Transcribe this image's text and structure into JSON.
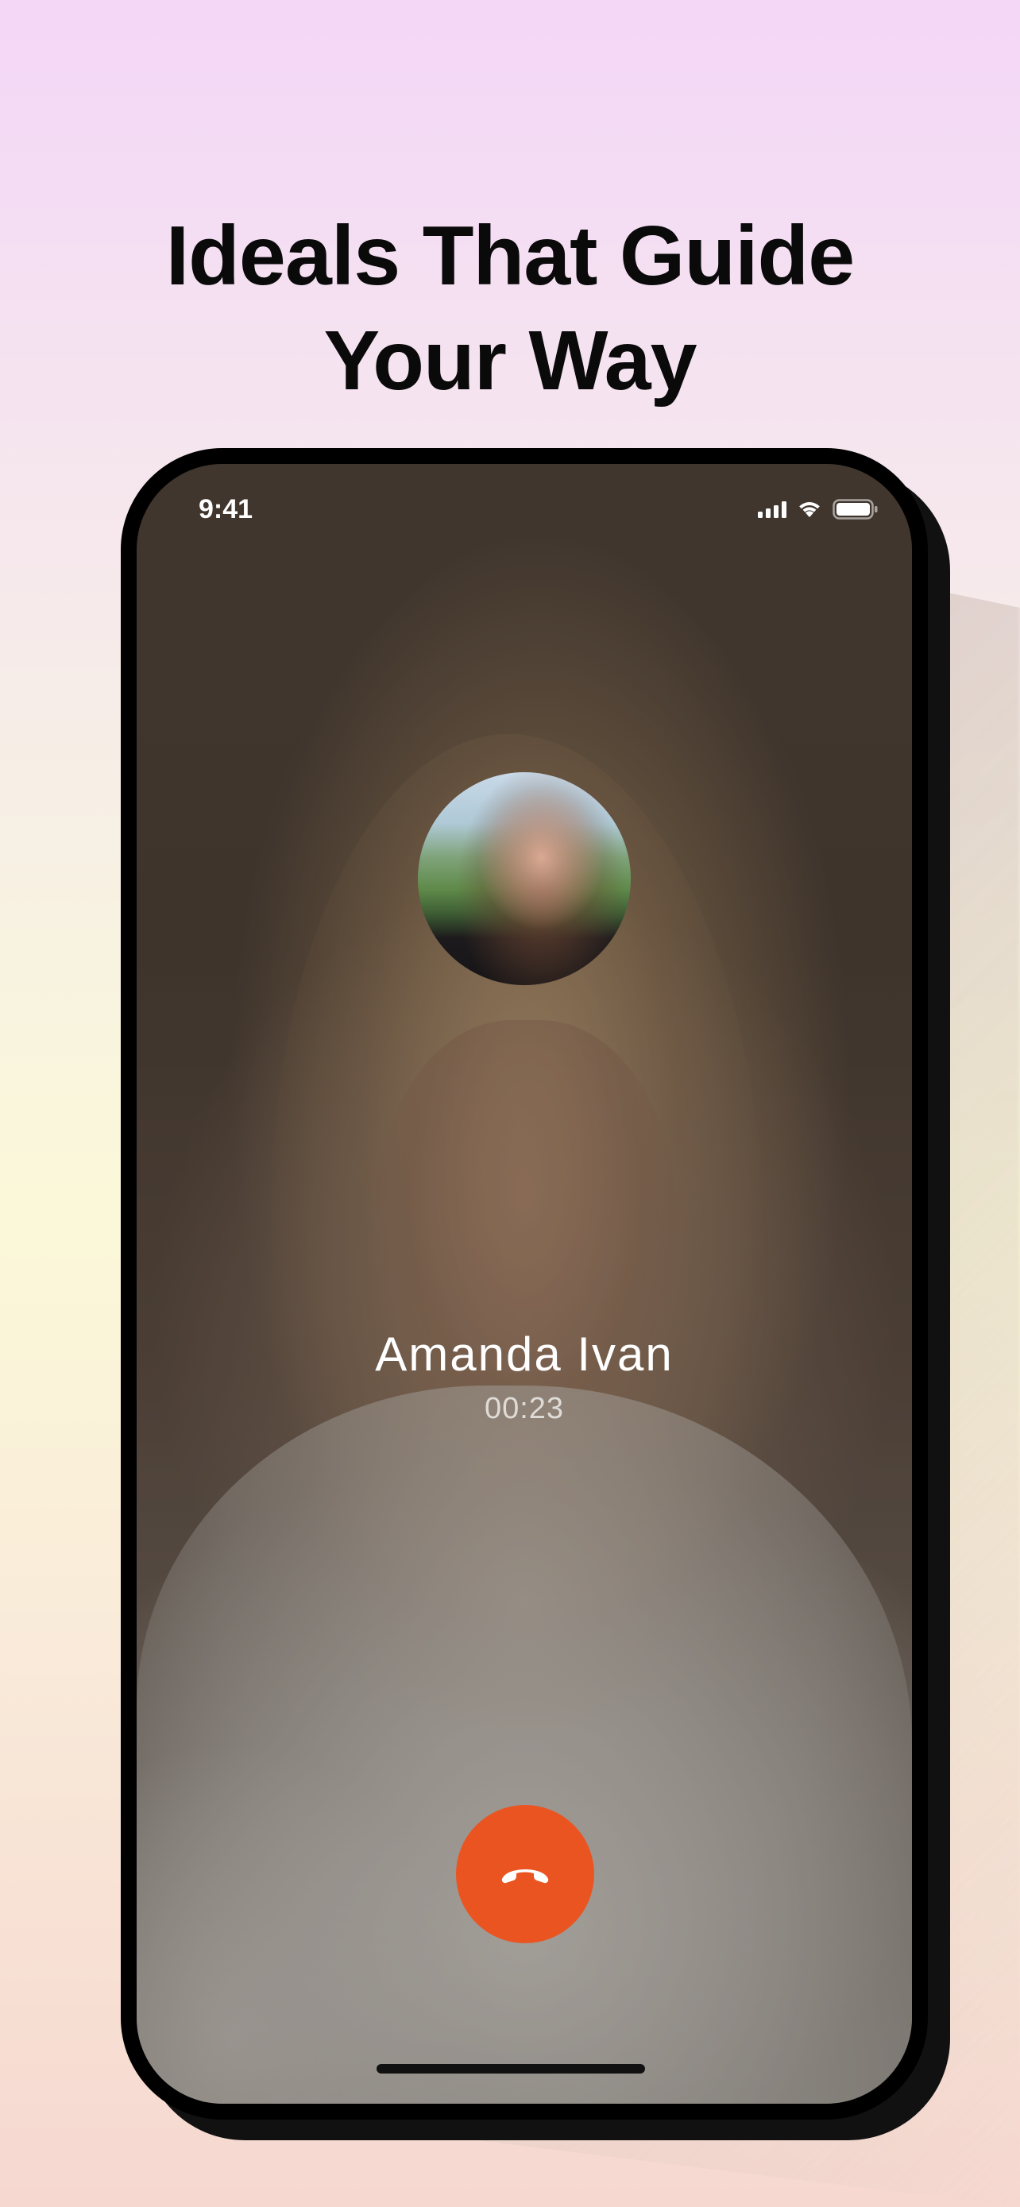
{
  "headline": {
    "line1": "Ideals That Guide",
    "line2": "Your Way"
  },
  "status_bar": {
    "time": "9:41",
    "icons": [
      "signal-icon",
      "wifi-icon",
      "battery-icon"
    ]
  },
  "call": {
    "caller_name": "Amanda Ivan",
    "duration": "00:23",
    "end_call_icon": "phone-hangup-icon",
    "end_call_color": "#EA5421"
  },
  "colors": {
    "headline": "#0A0A0A",
    "background_top": "#F4D6F7",
    "background_mid": "#FBF8D9",
    "background_bottom": "#F6D8D0"
  }
}
